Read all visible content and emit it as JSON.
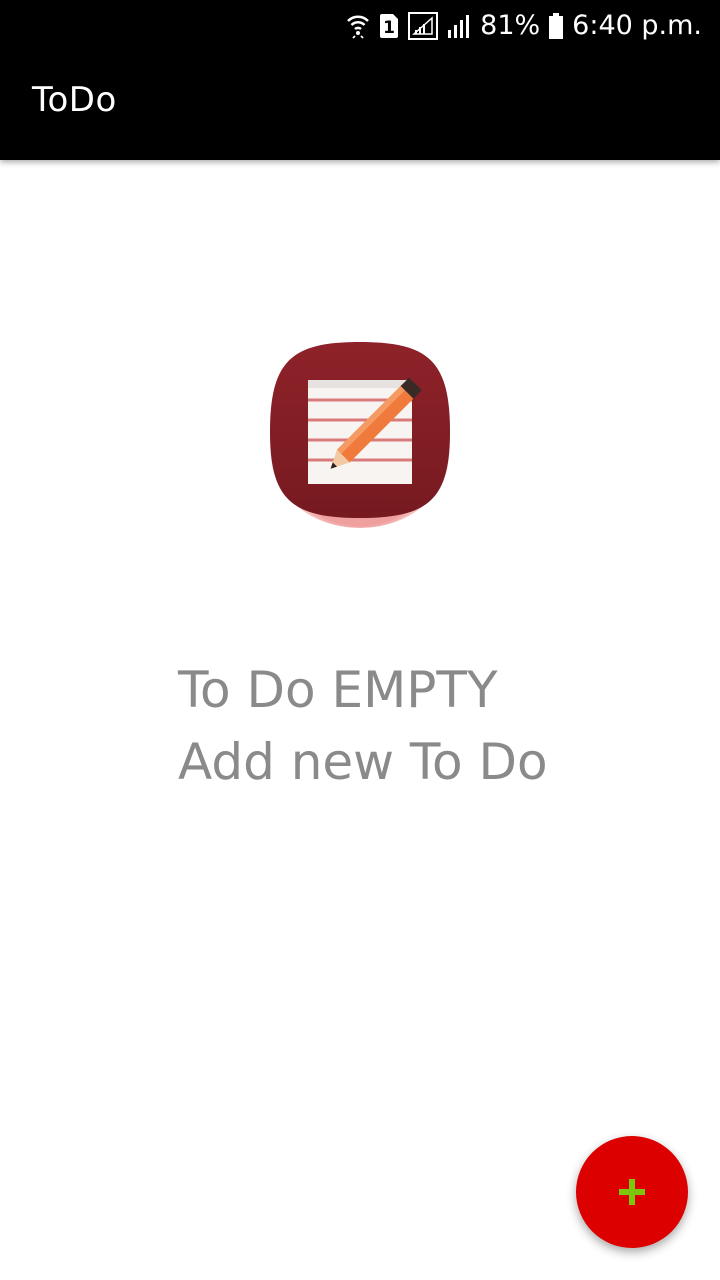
{
  "status_bar": {
    "battery": "81%",
    "time": "6:40 p.m.",
    "sim_label": "1",
    "icons": [
      "wifi-icon",
      "sim-icon",
      "signal-icon",
      "signal-icon",
      "battery-icon"
    ]
  },
  "app_bar": {
    "title": "ToDo"
  },
  "empty_state": {
    "line1": "To Do EMPTY",
    "line2": "Add new To Do",
    "icon": "notepad-pencil-icon"
  },
  "fab": {
    "icon": "plus-icon"
  },
  "colors": {
    "app_bar": "#000000",
    "fab": "#dd0000",
    "fab_icon": "#7ac70c",
    "empty_text": "#8a8a8a",
    "icon_bg": "#8b1e24"
  }
}
